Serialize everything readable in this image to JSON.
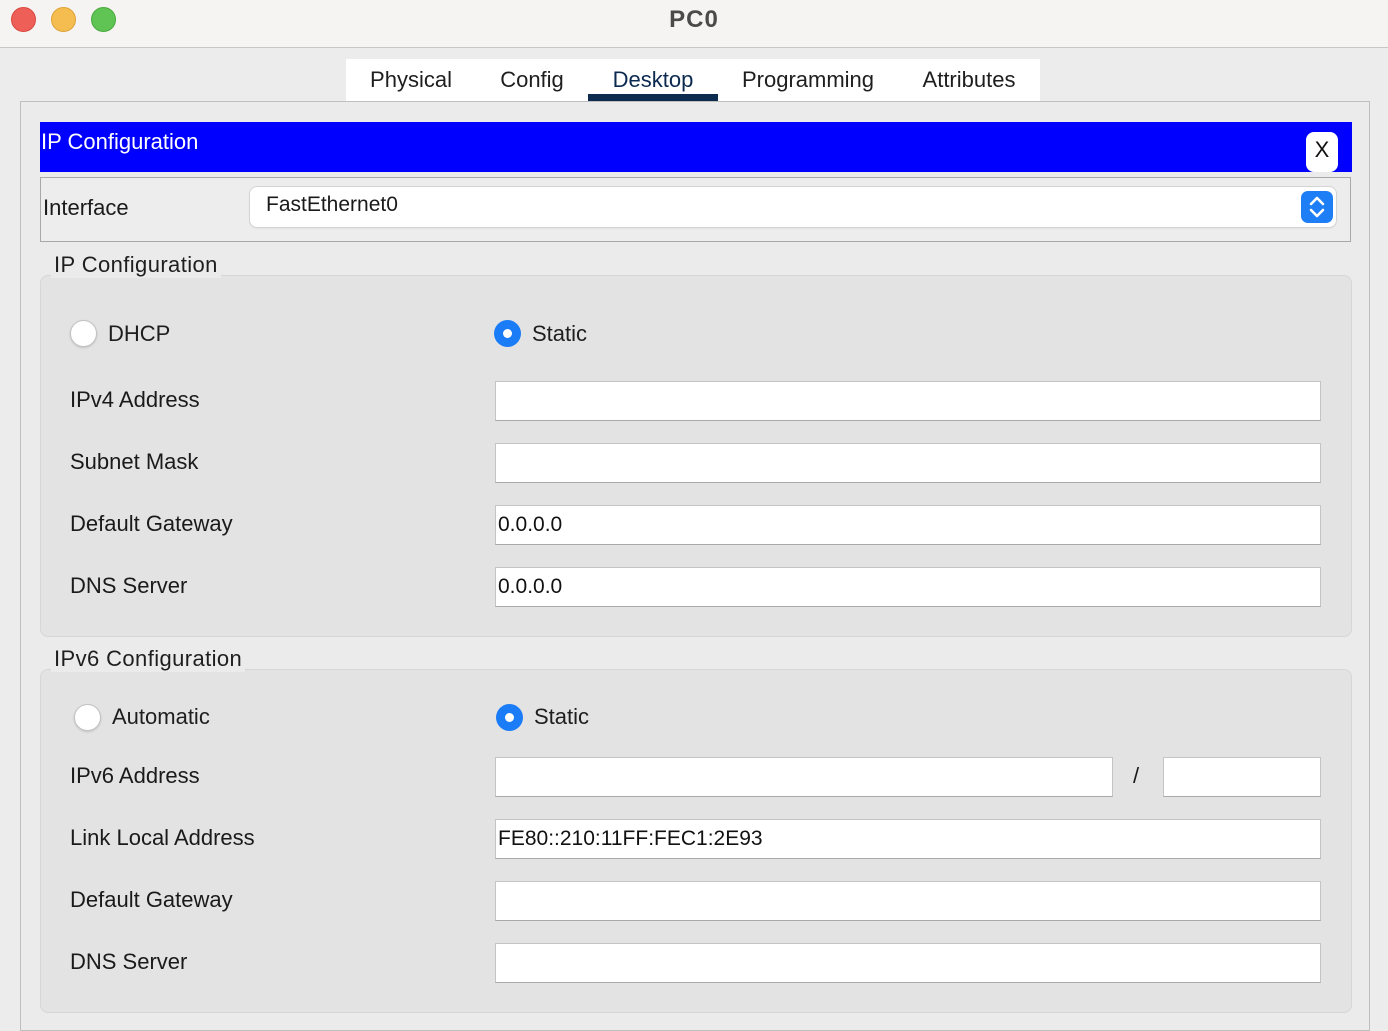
{
  "window": {
    "title": "PC0"
  },
  "tabs": [
    {
      "label": "Physical",
      "active": false
    },
    {
      "label": "Config",
      "active": false
    },
    {
      "label": "Desktop",
      "active": true
    },
    {
      "label": "Programming",
      "active": false
    },
    {
      "label": "Attributes",
      "active": false
    }
  ],
  "panel": {
    "title": "IP Configuration",
    "close_label": "X",
    "interface_label": "Interface",
    "interface_value": "FastEthernet0"
  },
  "ipv4": {
    "legend": "IP Configuration",
    "dhcp_label": "DHCP",
    "static_label": "Static",
    "mode": "Static",
    "fields": [
      {
        "label": "IPv4 Address",
        "value": ""
      },
      {
        "label": "Subnet Mask",
        "value": ""
      },
      {
        "label": "Default Gateway",
        "value": "0.0.0.0"
      },
      {
        "label": "DNS Server",
        "value": "0.0.0.0"
      }
    ]
  },
  "ipv6": {
    "legend": "IPv6 Configuration",
    "automatic_label": "Automatic",
    "static_label": "Static",
    "mode": "Static",
    "address_label": "IPv6 Address",
    "address_value": "",
    "prefix_separator": "/",
    "prefix_value": "",
    "fields": [
      {
        "label": "Link Local Address",
        "value": "FE80::210:11FF:FEC1:2E93"
      },
      {
        "label": "Default Gateway",
        "value": ""
      },
      {
        "label": "DNS Server",
        "value": ""
      }
    ]
  },
  "colors": {
    "header_bar": "#0000ff",
    "active_tab_underline": "#0d2b4e",
    "radio_selected": "#1a7cf6"
  },
  "icons": {
    "close": "close-x-icon",
    "select": "chevron-up-down-icon"
  }
}
